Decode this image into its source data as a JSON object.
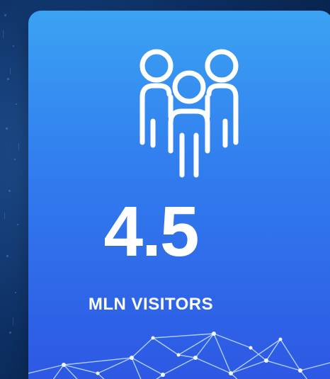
{
  "stat_card": {
    "value": "4.5",
    "label": "MLN VISITORS",
    "icon": "people-group-icon"
  },
  "decorations": {
    "network": "network-lines-icon"
  },
  "colors": {
    "background_dark": "#0d2f63",
    "card_top": "#2f9df2",
    "card_bottom": "#2d55e3",
    "foreground": "#ffffff"
  }
}
